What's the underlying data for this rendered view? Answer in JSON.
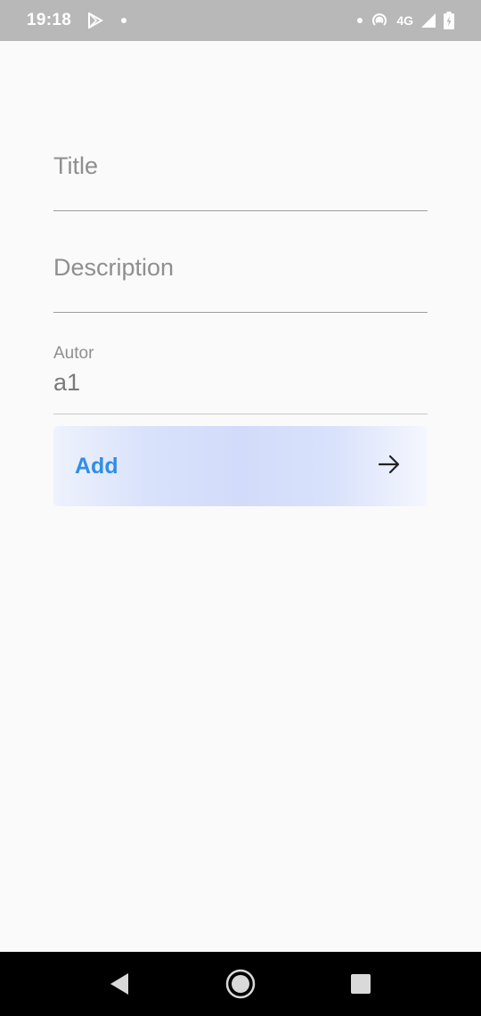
{
  "status_bar": {
    "time": "19:18",
    "network": "4G",
    "icons": [
      "play-store-icon",
      "notification-dot-icon",
      "hotspot-icon",
      "signal-icon",
      "battery-charging-icon"
    ]
  },
  "form": {
    "title_field": {
      "placeholder": "Title",
      "value": ""
    },
    "description_field": {
      "placeholder": "Description",
      "value": ""
    },
    "autor_field": {
      "label": "Autor",
      "value": "a1"
    }
  },
  "add_button": {
    "label": "Add",
    "icon": "arrow-right-icon",
    "label_color": "#2f8ee6",
    "gradient_colors": [
      "#eef2fd",
      "#d2dcfa",
      "#f5f7fe"
    ]
  },
  "nav_bar": {
    "buttons": [
      "back-icon",
      "home-icon",
      "recents-icon"
    ]
  },
  "colors": {
    "background": "#fafafa",
    "status_bar": "#b8b8b8",
    "nav_bar": "#000000",
    "hint_text": "#8f8f8f"
  }
}
